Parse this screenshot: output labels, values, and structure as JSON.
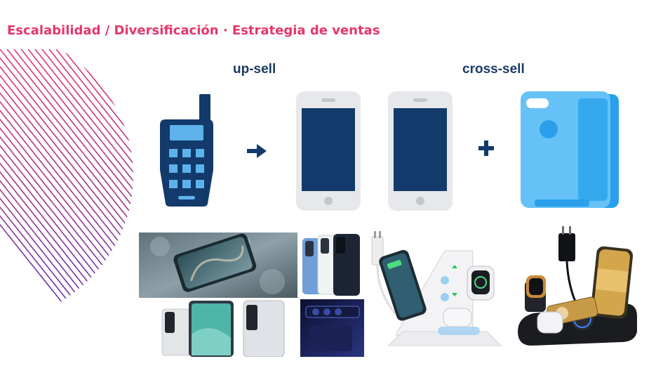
{
  "slide": {
    "title": "Escalabilidad / Diversificación · Estrategia de ventas",
    "upsell_label": "up-sell",
    "crosssell_label": "cross-sell"
  },
  "icons": {
    "old_phone": "feature-phone-icon",
    "arrow": "arrow-right-icon",
    "smartphone_a": "smartphone-icon",
    "smartphone_b": "smartphone-icon",
    "plus": "plus-icon",
    "case": "phone-case-icon"
  },
  "colors": {
    "title": "#e8366a",
    "label": "#1b3a66",
    "icon_navy": "#123a6b",
    "phone_frame": "#e6e8eb",
    "case_blue": "#4db5f0",
    "deco_purple": "#6a2fa8",
    "deco_pink": "#e8366a"
  }
}
